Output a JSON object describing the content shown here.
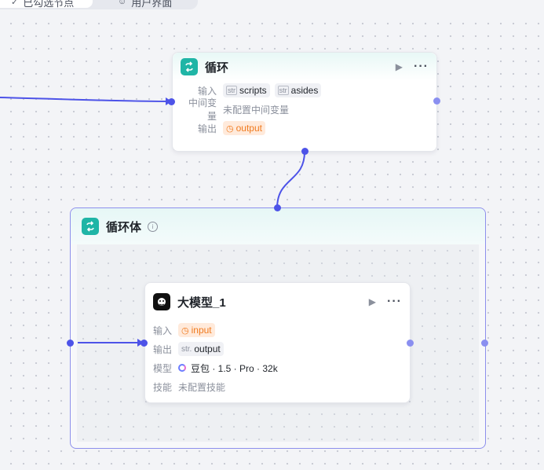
{
  "tabs": [
    {
      "label": "已勾选节点",
      "icon": "check-icon"
    },
    {
      "label": "用户界面",
      "icon": "user-icon"
    }
  ],
  "loop_node": {
    "title": "循环",
    "icon": "loop-icon",
    "input_label": "输入",
    "inputs": [
      {
        "type": "str",
        "name": "scripts"
      },
      {
        "type": "str",
        "name": "asides"
      }
    ],
    "midvar_label": "中间变量",
    "midvar_value": "未配置中间变量",
    "output_label": "输出",
    "output_value": "output"
  },
  "loop_body": {
    "title": "循环体",
    "icon": "loop-icon"
  },
  "llm_node": {
    "title": "大模型_1",
    "icon": "robot-icon",
    "input_label": "输入",
    "input_value": "input",
    "output_label": "输出",
    "output_type": "str.",
    "output_value": "output",
    "model_label": "模型",
    "model_value": "豆包 · 1.5 · Pro · 32k",
    "skill_label": "技能",
    "skill_value": "未配置技能"
  },
  "colors": {
    "accent": "#4d53e8",
    "loop_icon_bg": "#1fb5a6",
    "variable_chip": "#f07b20"
  }
}
